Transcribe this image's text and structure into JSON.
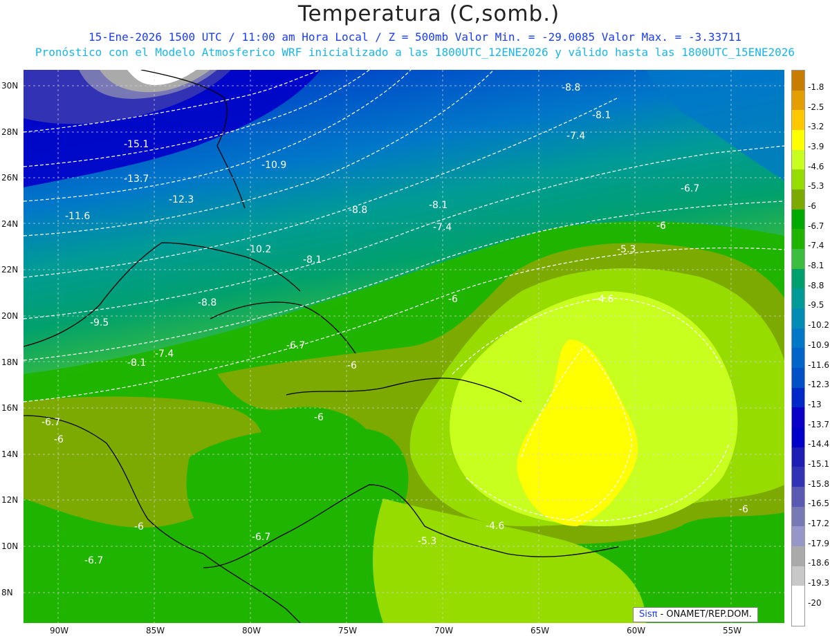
{
  "title": "Temperatura (C,somb.)",
  "subtitle_1": "15-Ene-2026  1500 UTC / 11:00 am Hora Local / Z = 500mb  Valor Min. = -29.0085  Valor Max. = -3.33711",
  "subtitle_2": "Pronóstico con el Modelo Atmosferico WRF inicializado a las 1800UTC_12ENE2026 y válido hasta las  1800UTC_15ENE2026",
  "credit_sis": "Sisπ",
  "credit_text": " - ONAMET/REP.DOM.",
  "lat_ticks": [
    "30N",
    "28N",
    "26N",
    "24N",
    "22N",
    "20N",
    "18N",
    "16N",
    "14N",
    "12N",
    "10N",
    "8N"
  ],
  "lon_ticks": [
    "90W",
    "85W",
    "80W",
    "75W",
    "70W",
    "65W",
    "60W",
    "55W"
  ],
  "legend": {
    "labels": [
      "-1.8",
      "-2.5",
      "-3.2",
      "-3.9",
      "-4.6",
      "-5.3",
      "-6",
      "-6.7",
      "-7.4",
      "-8.1",
      "-8.8",
      "-9.5",
      "-10.2",
      "-10.9",
      "-11.6",
      "-12.3",
      "-13",
      "-13.7",
      "-14.4",
      "-15.1",
      "-15.8",
      "-16.5",
      "-17.2",
      "-17.9",
      "-18.6",
      "-19.3",
      "-20"
    ],
    "colors": [
      "#c87d00",
      "#e49e00",
      "#ffc800",
      "#ffff00",
      "#c8ff1e",
      "#96dc00",
      "#7daa00",
      "#00aa00",
      "#1eb400",
      "#3cbe3c",
      "#00a06e",
      "#009b96",
      "#008cb4",
      "#0078c8",
      "#0064c8",
      "#0050c8",
      "#0028c8",
      "#0a00c8",
      "#0000c8",
      "#1e1eb4",
      "#3232b4",
      "#5a5ab4",
      "#7878b4",
      "#9696c8",
      "#aaaaaa",
      "#c8c8c8",
      "#ffffff"
    ]
  },
  "contour_labels": [
    "-8.8",
    "-8.1",
    "-7.4",
    "-6.7",
    "-6",
    "-15.1",
    "-10.9",
    "-13.7",
    "-12.3",
    "-8.8",
    "-8.1",
    "-11.6",
    "-7.4",
    "-6",
    "-10.2",
    "-8.1",
    "-5.3",
    "-8.8",
    "-6",
    "-4.6",
    "-9.5",
    "-6.7",
    "-7.4",
    "-8.1",
    "-6",
    "-6",
    "-6.7",
    "-6",
    "-6",
    "-6.7",
    "-6.7",
    "-5.3",
    "-4.6",
    "-6"
  ]
}
